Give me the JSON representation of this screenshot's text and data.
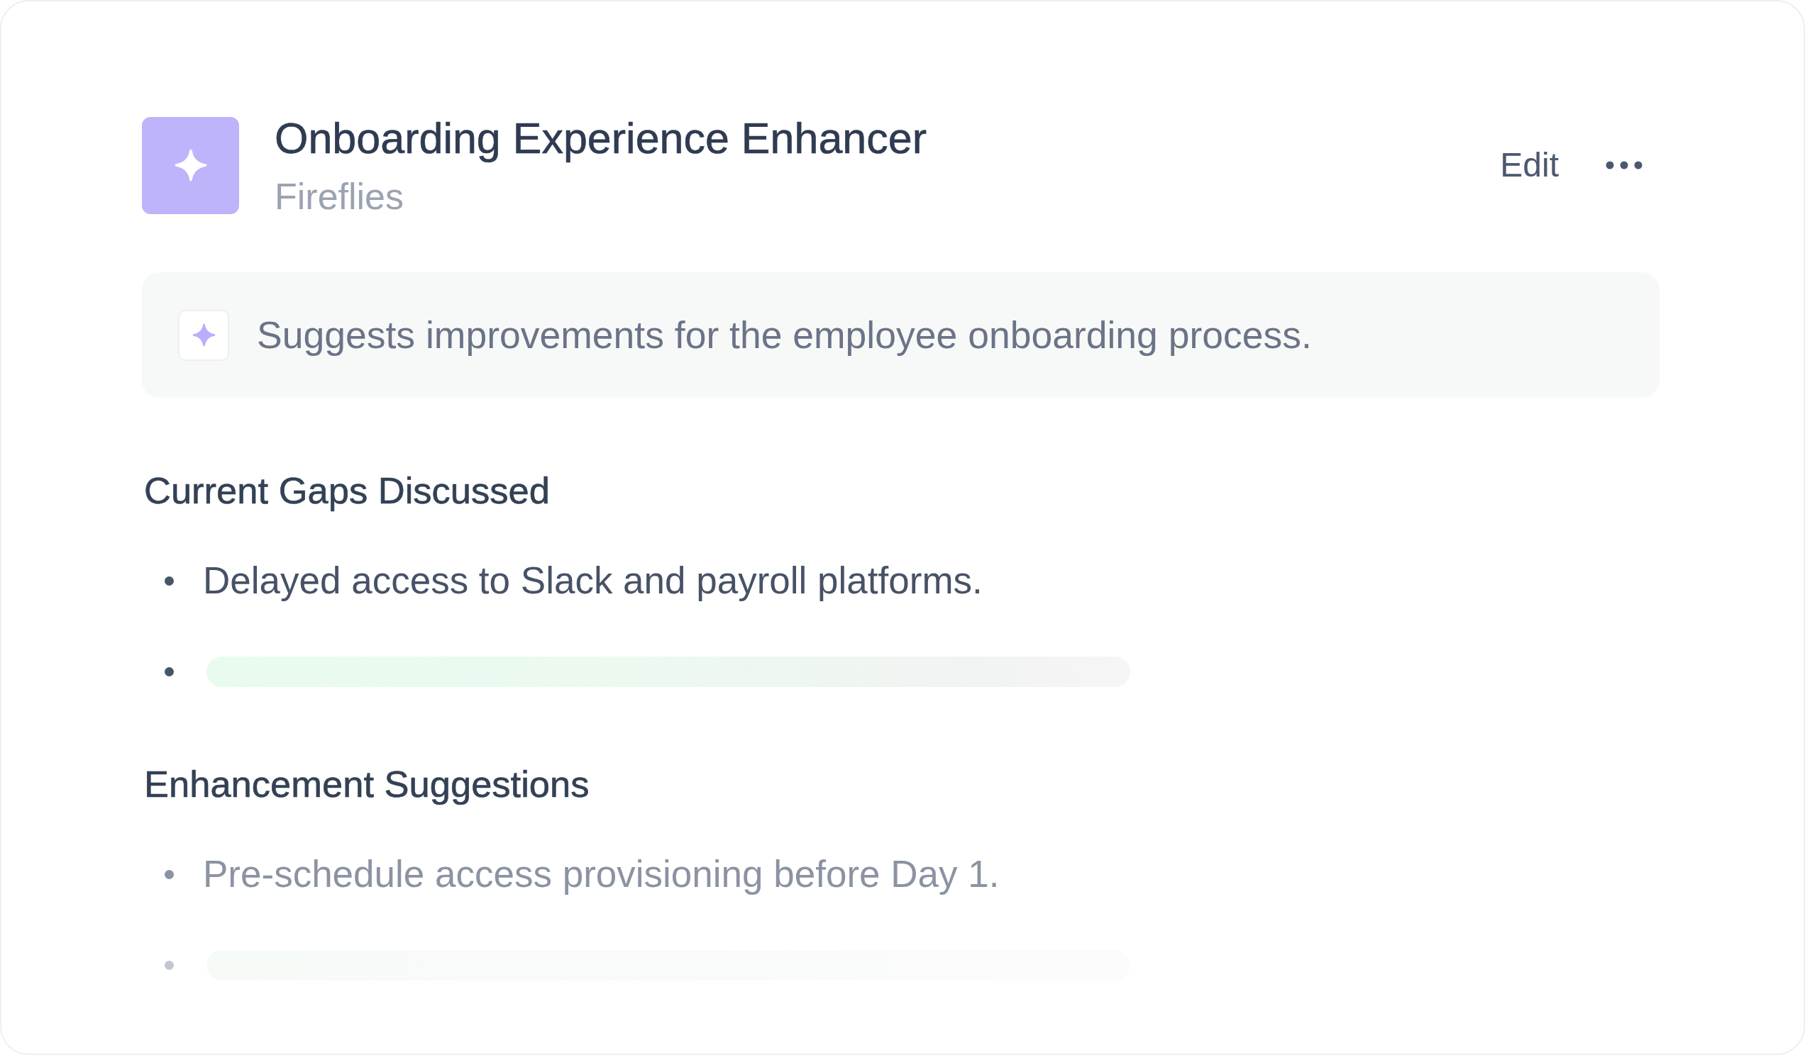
{
  "header": {
    "title": "Onboarding Experience Enhancer",
    "subtitle": "Fireflies",
    "edit_button": "Edit"
  },
  "summary": {
    "text": "Suggests improvements for the employee onboarding process."
  },
  "sections": [
    {
      "heading": "Current Gaps Discussed",
      "items": [
        {
          "kind": "text",
          "text": "Delayed access to Slack and payroll platforms.",
          "faded": false
        },
        {
          "kind": "skeleton",
          "faded": false
        }
      ]
    },
    {
      "heading": "Enhancement Suggestions",
      "items": [
        {
          "kind": "text",
          "text": "Pre-schedule access provisioning before Day 1.",
          "faded": true
        },
        {
          "kind": "skeleton",
          "faded": true
        }
      ]
    }
  ]
}
